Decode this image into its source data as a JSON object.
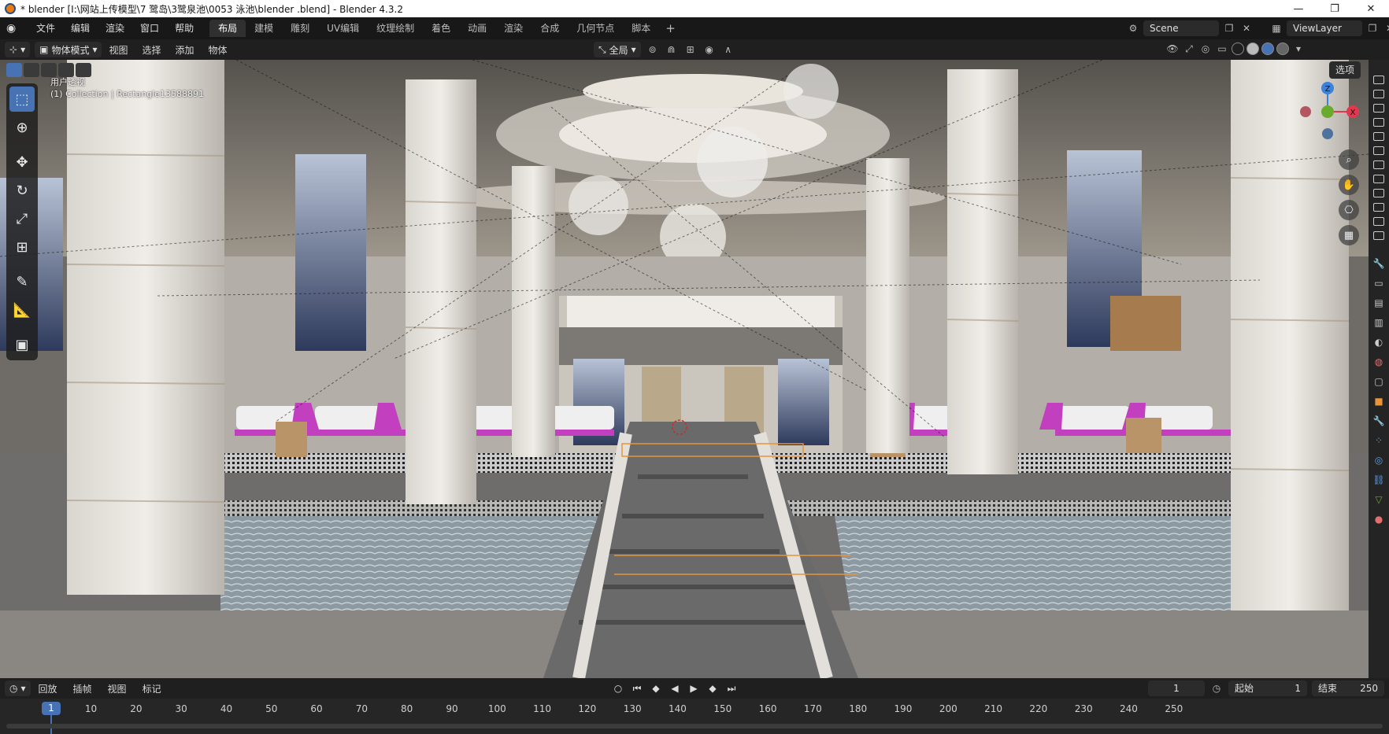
{
  "window": {
    "title": "* blender  [I:\\网站上传模型\\7 鹭岛\\3鹭泉池\\0053 泳池\\blender .blend] - Blender 4.3.2",
    "controls": [
      "—",
      "❐",
      "✕"
    ]
  },
  "menubar": {
    "menus": [
      "文件",
      "编辑",
      "渲染",
      "窗口",
      "帮助"
    ],
    "workspace_tabs": [
      "布局",
      "建模",
      "雕刻",
      "UV编辑",
      "纹理绘制",
      "着色",
      "动画",
      "渲染",
      "合成",
      "几何节点",
      "脚本"
    ],
    "active_tab": "布局",
    "add_tab": "+",
    "scene": "Scene",
    "view_layer": "ViewLayer"
  },
  "viewport_header": {
    "mode": "物体模式",
    "menus": [
      "视图",
      "选择",
      "添加",
      "物体"
    ],
    "transform_orientation": "全局",
    "options_button": "选项"
  },
  "viewport": {
    "view_name": "用户透视",
    "object_info": "(1) Collection | Rectangle13588891",
    "gizmo_axes": {
      "x": "X",
      "y": "Y",
      "z": "Z"
    },
    "tools": [
      "select-box",
      "cursor",
      "move",
      "rotate",
      "scale",
      "transform",
      "annotate",
      "measure",
      "add-cube"
    ],
    "active_tool": "select-box"
  },
  "timeline": {
    "menus": [
      "回放",
      "插帧",
      "视图",
      "标记"
    ],
    "current_frame": "1",
    "start_label": "起始",
    "start_value": "1",
    "end_label": "结束",
    "end_value": "250",
    "ruler_ticks": [
      "10",
      "20",
      "30",
      "40",
      "50",
      "60",
      "70",
      "80",
      "90",
      "100",
      "110",
      "120",
      "130",
      "140",
      "150",
      "160",
      "170",
      "180",
      "190",
      "200",
      "210",
      "220",
      "230",
      "240",
      "250"
    ]
  },
  "colors": {
    "accent": "#4772b3",
    "x_axis": "#e0394f",
    "y_axis": "#6aab2e",
    "z_axis": "#3b82d8"
  }
}
